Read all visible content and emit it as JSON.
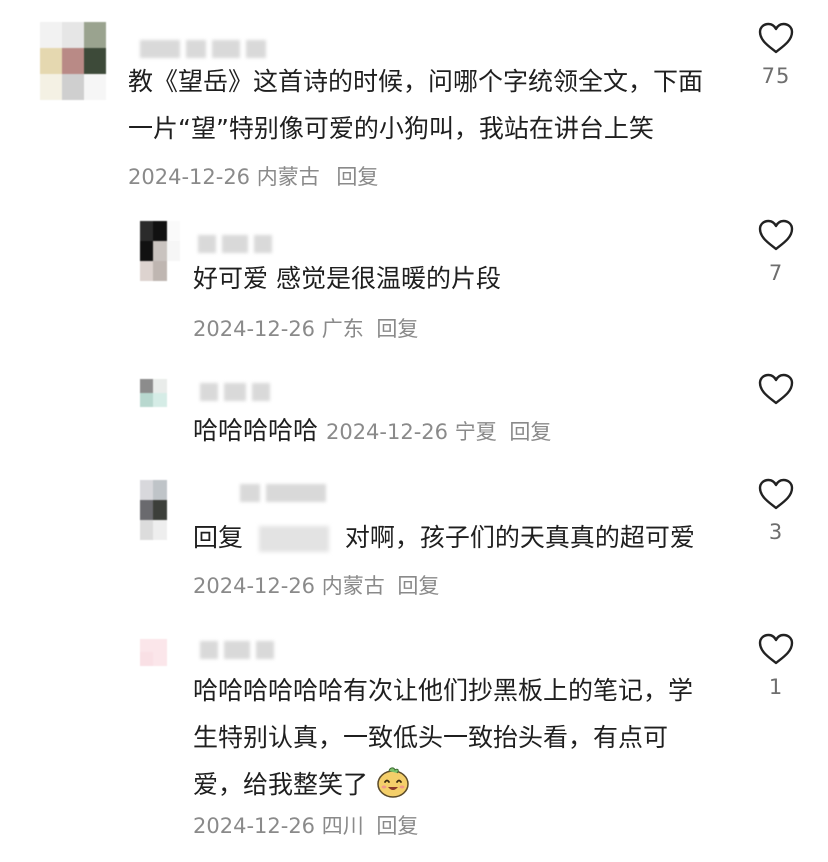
{
  "comments": [
    {
      "text": "教《望岳》这首诗的时候，问哪个字统领全文，下面一片“望”特别像可爱的小狗叫，我站在讲台上笑",
      "date": "2024-12-26",
      "location": "内蒙古",
      "reply_label": "回复",
      "likes": "75"
    }
  ],
  "replies": [
    {
      "text": "好可爱 感觉是很温暖的片段",
      "date": "2024-12-26",
      "location": "广东",
      "reply_label": "回复",
      "likes": "7"
    },
    {
      "text": "哈哈哈哈哈",
      "date": "2024-12-26",
      "location": "宁夏",
      "reply_label": "回复",
      "likes": ""
    },
    {
      "prefix": "回复",
      "text": "对啊，孩子们的天真真的超可爱",
      "date": "2024-12-26",
      "location": "内蒙古",
      "reply_label": "回复",
      "likes": "3"
    },
    {
      "text": "哈哈哈哈哈哈有次让他们抄黑板上的笔记，学生特别认真，一致低头一致抬头看，有点可爱，给我整笑了",
      "date": "2024-12-26",
      "location": "四川",
      "reply_label": "回复",
      "likes": "1"
    }
  ],
  "icons": {
    "like": "heart-outline-icon",
    "emoji": "smiling-emoji-icon"
  },
  "colors": {
    "text": "#1f1f1f",
    "meta": "#8a8a8a",
    "like_count": "#6e6e6e"
  }
}
